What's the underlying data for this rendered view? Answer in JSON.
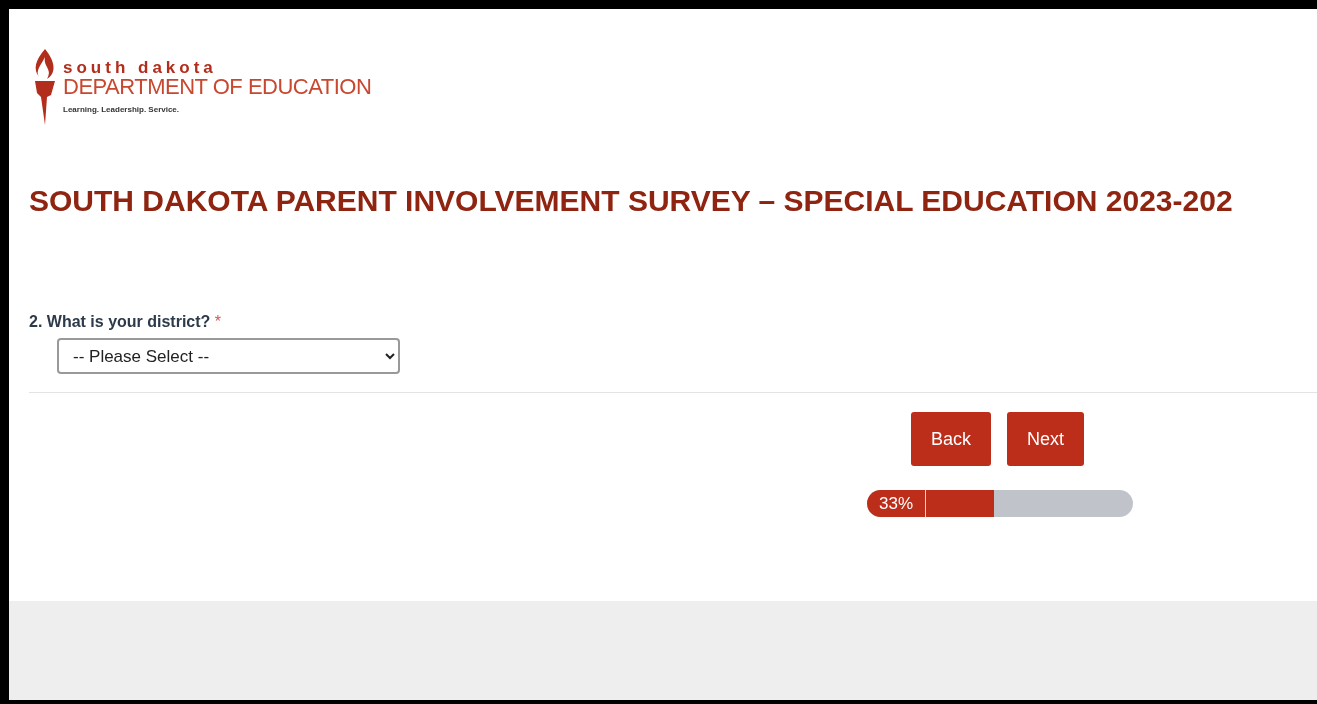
{
  "logo": {
    "line_1": "south dakota",
    "line_2": "DEPARTMENT OF EDUCATION",
    "tagline": "Learning. Leadership. Service."
  },
  "title": "SOUTH DAKOTA PARENT INVOLVEMENT SURVEY – SPECIAL EDUCATION 2023-202",
  "question": {
    "number": "2.",
    "label": "What is your district?",
    "required_mark": "*",
    "value": "-- Please Select --"
  },
  "buttons": [
    {
      "label": "Back"
    },
    {
      "label": "Next"
    }
  ],
  "progress": {
    "reading": "33%",
    "level": 0.33
  }
}
